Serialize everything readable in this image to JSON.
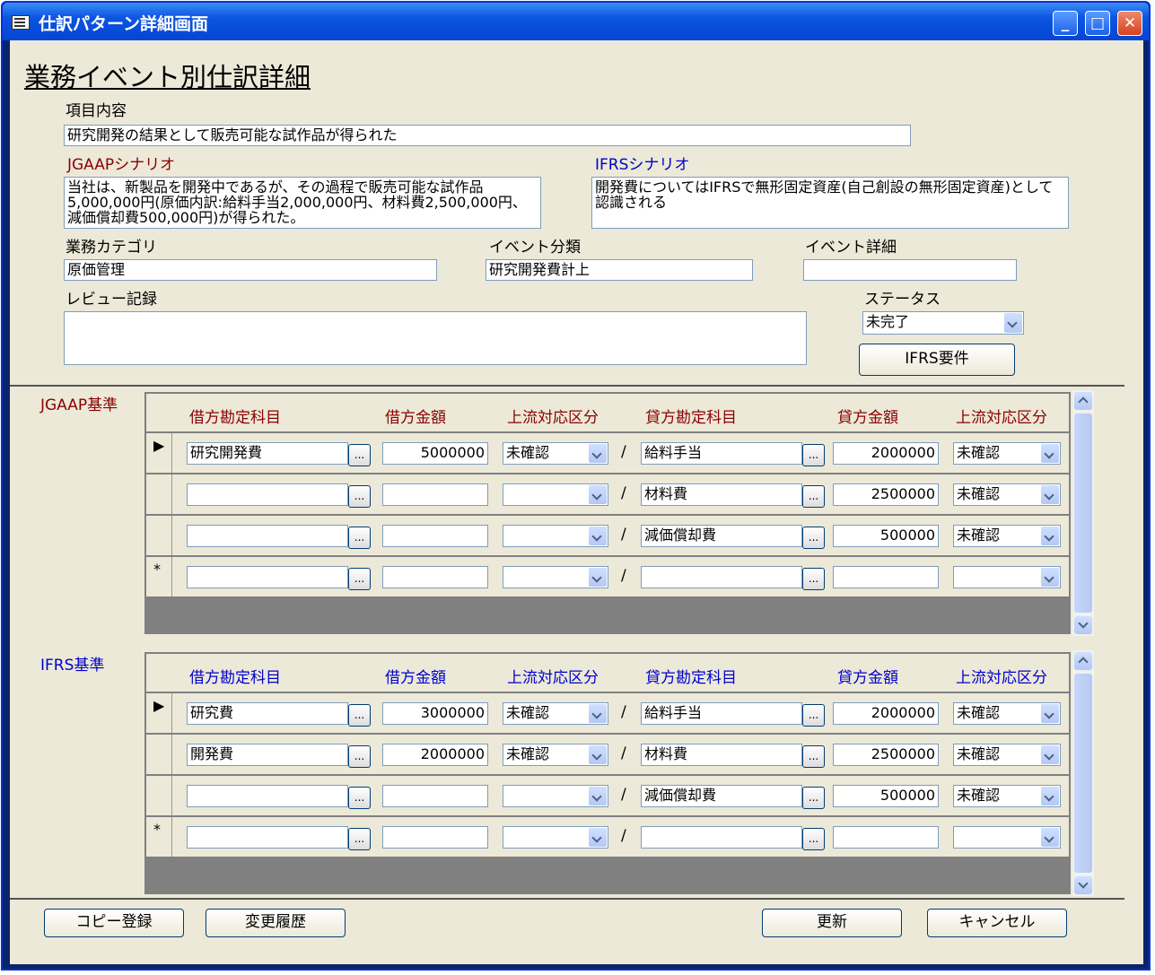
{
  "window": {
    "title": "仕訳パターン詳細画面",
    "minimize": "_",
    "maximize": "□",
    "close": "✕"
  },
  "form": {
    "heading": "業務イベント別仕訳詳細",
    "item_label": "項目内容",
    "item_value": "研究開発の結果として販売可能な試作品が得られた",
    "jgaap_scenario_label": "JGAAPシナリオ",
    "jgaap_scenario_value": "当社は、新製品を開発中であるが、その過程で販売可能な試作品5,000,000円(原価内訳:給料手当2,000,000円、材料費2,500,000円、減価償却費500,000円)が得られた。",
    "ifrs_scenario_label": "IFRSシナリオ",
    "ifrs_scenario_value": "開発費についてはIFRSで無形固定資産(自己創設の無形固定資産)として認識される",
    "category_label": "業務カテゴリ",
    "category_value": "原価管理",
    "event_class_label": "イベント分類",
    "event_class_value": "研究開発費計上",
    "event_detail_label": "イベント詳細",
    "event_detail_value": "",
    "review_label": "レビュー記録",
    "review_value": "",
    "status_label": "ステータス",
    "status_value": "未完了",
    "ifrs_req_button": "IFRS要件"
  },
  "columns": [
    "借方勘定科目",
    "借方金額",
    "上流対応区分",
    "貸方勘定科目",
    "貸方金額",
    "上流対応区分"
  ],
  "jgaap": {
    "label": "JGAAP基準",
    "rows": [
      {
        "marker": "▶",
        "debit_account": "研究開発費",
        "debit_amount": "5000000",
        "debit_flag": "未確認",
        "credit_account": "給料手当",
        "credit_amount": "2000000",
        "credit_flag": "未確認"
      },
      {
        "marker": "",
        "debit_account": "",
        "debit_amount": "",
        "debit_flag": "",
        "credit_account": "材料費",
        "credit_amount": "2500000",
        "credit_flag": "未確認"
      },
      {
        "marker": "",
        "debit_account": "",
        "debit_amount": "",
        "debit_flag": "",
        "credit_account": "減価償却費",
        "credit_amount": "500000",
        "credit_flag": "未確認"
      },
      {
        "marker": "*",
        "debit_account": "",
        "debit_amount": "",
        "debit_flag": "",
        "credit_account": "",
        "credit_amount": "",
        "credit_flag": ""
      }
    ]
  },
  "ifrs": {
    "label": "IFRS基準",
    "rows": [
      {
        "marker": "▶",
        "debit_account": "研究費",
        "debit_amount": "3000000",
        "debit_flag": "未確認",
        "credit_account": "給料手当",
        "credit_amount": "2000000",
        "credit_flag": "未確認"
      },
      {
        "marker": "",
        "debit_account": "開発費",
        "debit_amount": "2000000",
        "debit_flag": "未確認",
        "credit_account": "材料費",
        "credit_amount": "2500000",
        "credit_flag": "未確認"
      },
      {
        "marker": "",
        "debit_account": "",
        "debit_amount": "",
        "debit_flag": "",
        "credit_account": "減価償却費",
        "credit_amount": "500000",
        "credit_flag": "未確認"
      },
      {
        "marker": "*",
        "debit_account": "",
        "debit_amount": "",
        "debit_flag": "",
        "credit_account": "",
        "credit_amount": "",
        "credit_flag": ""
      }
    ]
  },
  "grid_symbols": {
    "slash": "/",
    "lookup": "..."
  },
  "footer": {
    "copy_button": "コピー登録",
    "history_button": "変更履歴",
    "update_button": "更新",
    "cancel_button": "キャンセル"
  }
}
